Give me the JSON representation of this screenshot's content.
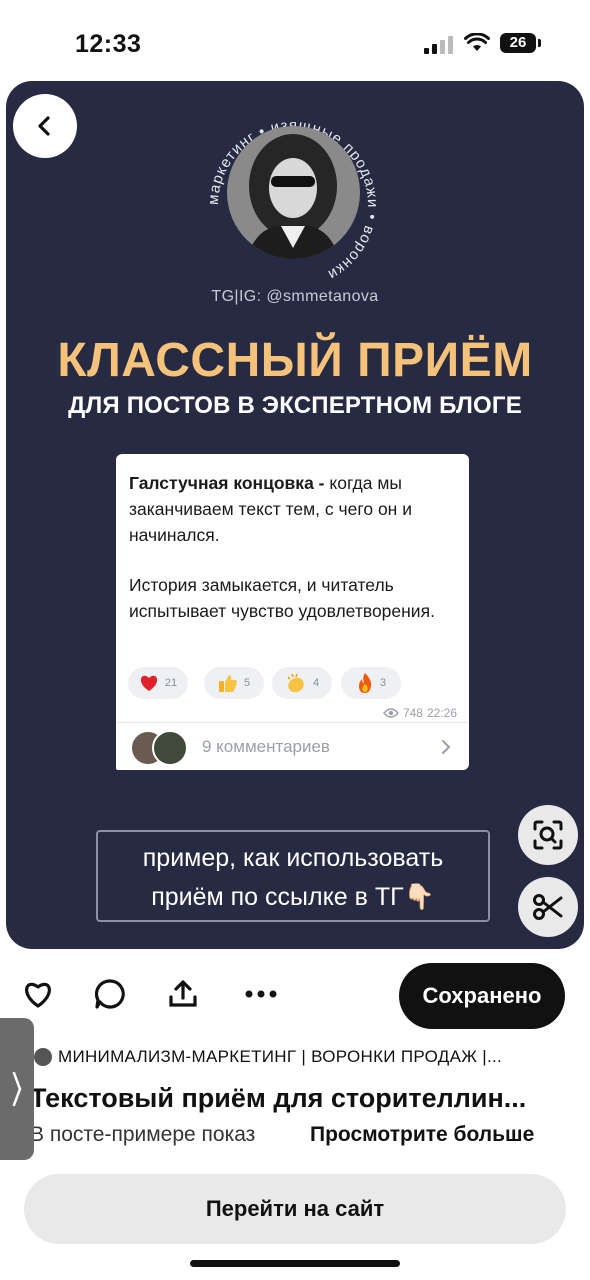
{
  "status_bar": {
    "time": "12:33",
    "battery": "26"
  },
  "pin": {
    "avatar_ring_text": "маркетинг • изящные продажи • воронки",
    "handle": "TG|IG: @smmetanova",
    "headline": "КЛАССНЫЙ ПРИЁМ",
    "subheadline": "ДЛЯ ПОСТОВ В ЭКСПЕРТНОМ БЛОГЕ",
    "message": {
      "bold_lead": "Галстучная концовка - ",
      "text1": "когда мы заканчиваем текст тем, с чего он и начинался.",
      "text2": "История замыкается, и читатель испытывает чувство удовлетворения.",
      "reactions": [
        {
          "icon": "heart-icon",
          "count": "21"
        },
        {
          "icon": "thumbs-up-icon",
          "count": "5"
        },
        {
          "icon": "clap-icon",
          "count": "4"
        },
        {
          "icon": "fire-icon",
          "count": "3"
        }
      ],
      "views": "748",
      "time": "22:26",
      "comments": "9 комментариев"
    },
    "cta_line1": "пример, как использовать",
    "cta_line2": "приём по ссылке в ТГ👇🏻"
  },
  "actions": {
    "saved_label": "Сохранено"
  },
  "board": "МИНИМАЛИЗМ-МАРКЕТИНГ  | ВОРОНКИ ПРОДАЖ |...",
  "title": "Текстовый приём для сторителлин...",
  "description": "В посте-примере показ",
  "see_more": "Просмотрите больше",
  "visit_label": "Перейти на сайт"
}
